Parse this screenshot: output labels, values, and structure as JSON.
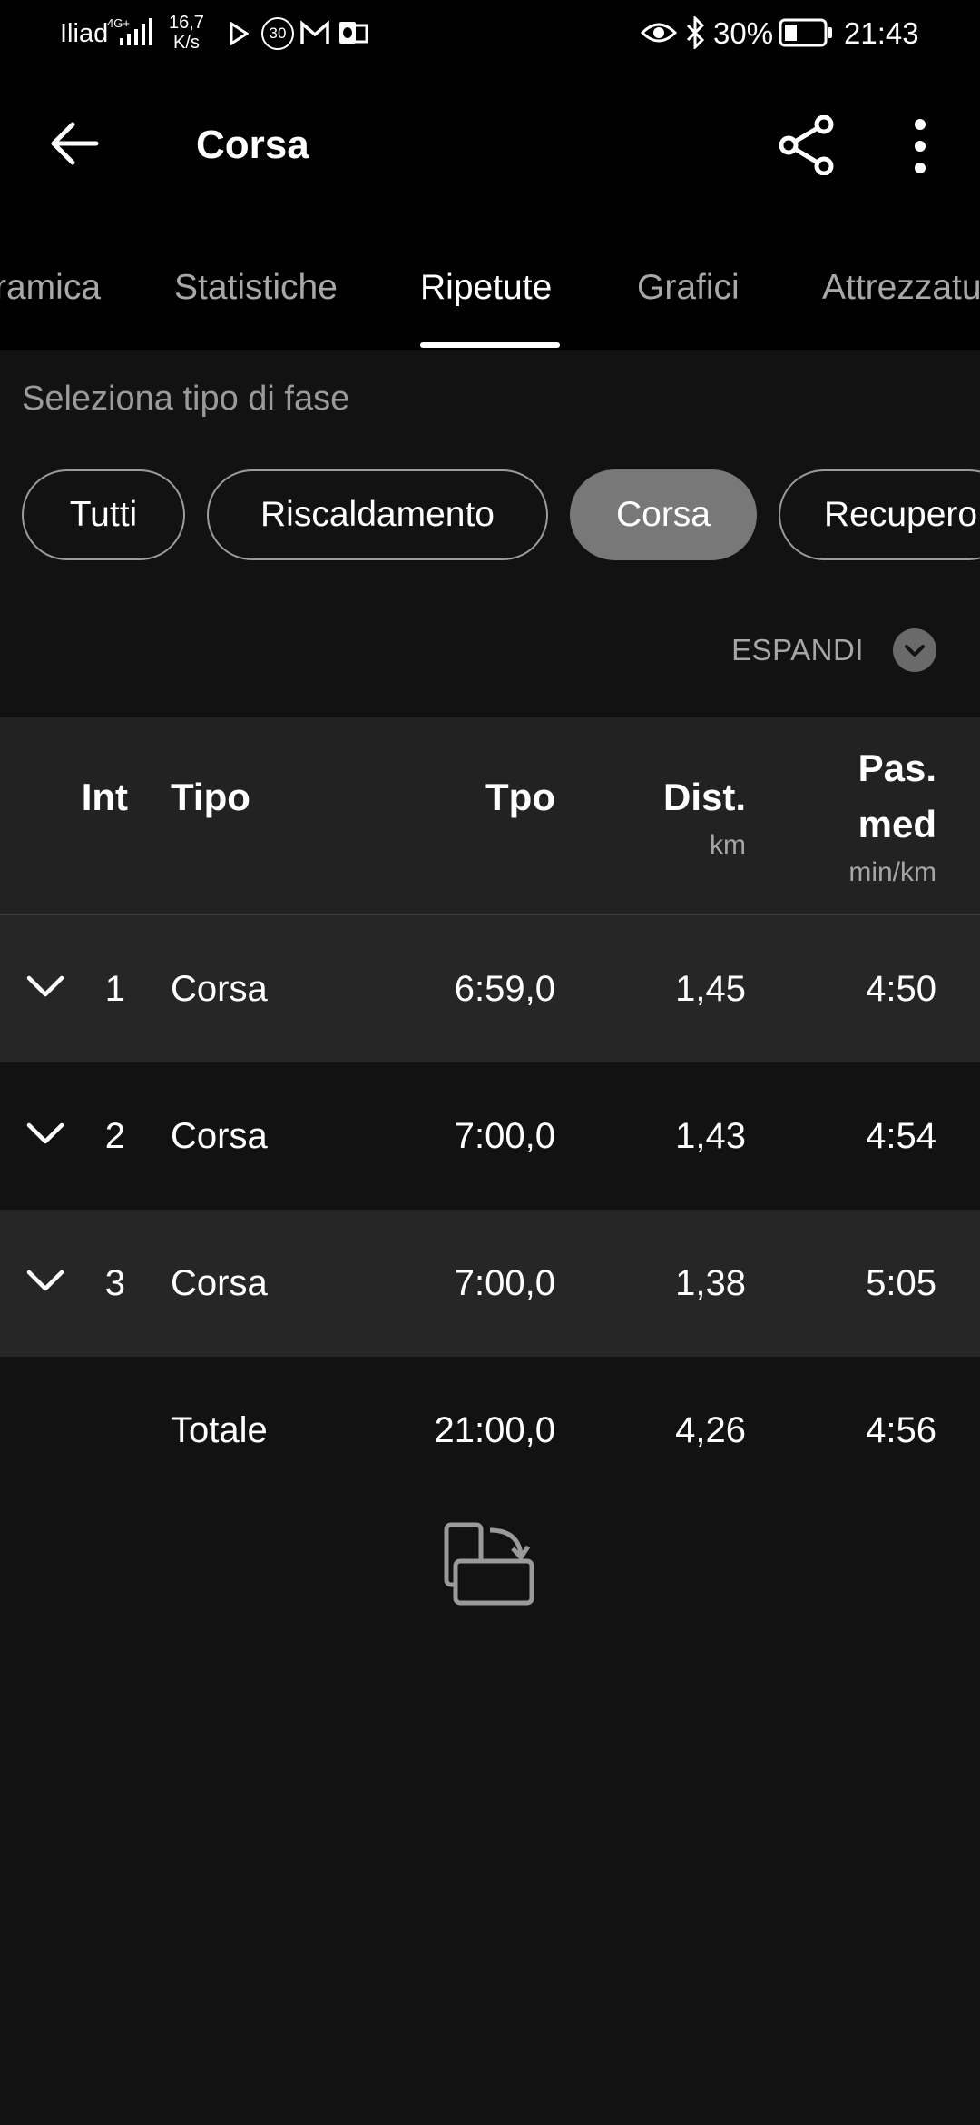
{
  "status_bar": {
    "carrier": "Iliad",
    "network": "4G+",
    "speed_value": "16,7",
    "speed_unit": "K/s",
    "notification_badge": "30",
    "battery": "30%",
    "time": "21:43"
  },
  "app_bar": {
    "title": "Corsa",
    "icons": [
      "back-arrow-icon",
      "share-icon",
      "more-vert-icon"
    ]
  },
  "tabs": [
    {
      "label": "ramica",
      "active": false
    },
    {
      "label": "Statistiche",
      "active": false
    },
    {
      "label": "Ripetute",
      "active": true
    },
    {
      "label": "Grafici",
      "active": false
    },
    {
      "label": "Attrezzatu",
      "active": false
    }
  ],
  "phase_selector": {
    "label": "Seleziona tipo di fase",
    "chips": [
      {
        "label": "Tutti",
        "selected": false
      },
      {
        "label": "Riscaldamento",
        "selected": false
      },
      {
        "label": "Corsa",
        "selected": true
      },
      {
        "label": "Recupero",
        "selected": false
      }
    ]
  },
  "expand": {
    "label": "ESPANDI"
  },
  "table": {
    "headers": {
      "int": "Int",
      "tipo": "Tipo",
      "tpo": "Tpo",
      "dist": "Dist.",
      "dist_unit": "km",
      "pace_line1": "Pas.",
      "pace_line2": "med",
      "pace_unit": "min/km"
    },
    "rows": [
      {
        "int": "1",
        "tipo": "Corsa",
        "tpo": "6:59,0",
        "dist": "1,45",
        "pace": "4:50"
      },
      {
        "int": "2",
        "tipo": "Corsa",
        "tpo": "7:00,0",
        "dist": "1,43",
        "pace": "4:54"
      },
      {
        "int": "3",
        "tipo": "Corsa",
        "tpo": "7:00,0",
        "dist": "1,38",
        "pace": "5:05"
      }
    ],
    "total": {
      "label": "Totale",
      "tpo": "21:00,0",
      "dist": "4,26",
      "pace": "4:56"
    }
  },
  "colors": {
    "background": "#121212",
    "header_bg": "#000000",
    "selected_chip": "#787878",
    "alt_row": "#262626"
  }
}
